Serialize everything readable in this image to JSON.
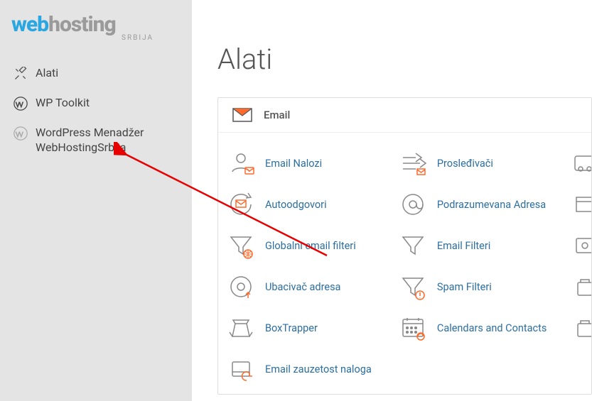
{
  "logo": {
    "part1": "web",
    "part2": "host",
    "part3": "ing",
    "sub": "SRBIJA"
  },
  "sidebar": {
    "items": [
      {
        "label": "Alati"
      },
      {
        "label": "WP Toolkit"
      },
      {
        "label": "WordPress Menadžer WebHostingSrbija"
      }
    ]
  },
  "page": {
    "title": "Alati"
  },
  "panel": {
    "title": "Email"
  },
  "tools": {
    "col1": [
      {
        "label": "Email Nalozi"
      },
      {
        "label": "Autoodgovori"
      },
      {
        "label": "Globalni email filteri"
      },
      {
        "label": "Ubacivač adresa"
      },
      {
        "label": "BoxTrapper"
      },
      {
        "label": "Email zauzetost naloga"
      }
    ],
    "col2": [
      {
        "label": "Prosleđivači"
      },
      {
        "label": "Podrazumevana Adresa"
      },
      {
        "label": "Email Filteri"
      },
      {
        "label": "Spam Filteri"
      },
      {
        "label": "Calendars and Contacts"
      }
    ]
  }
}
